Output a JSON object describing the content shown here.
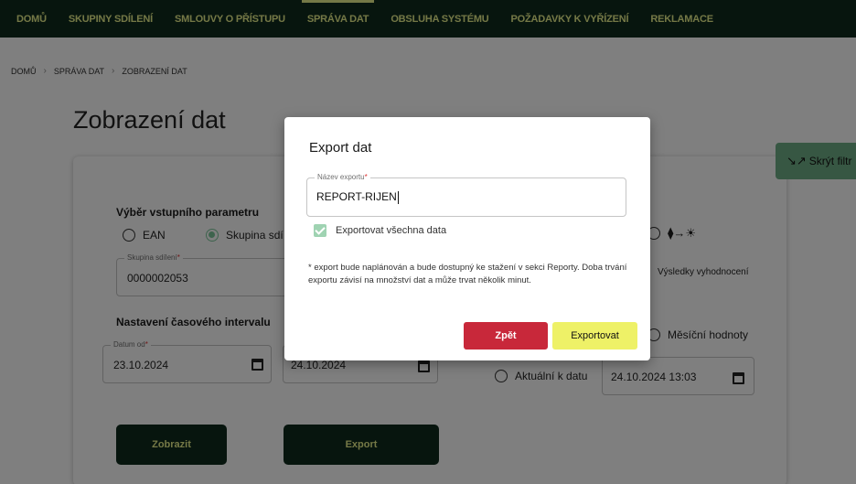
{
  "nav": {
    "items": [
      {
        "label": "DOMŮ"
      },
      {
        "label": "SKUPINY SDÍLENÍ"
      },
      {
        "label": "SMLOUVY O PŘÍSTUPU"
      },
      {
        "label": "SPRÁVA DAT"
      },
      {
        "label": "OBSLUHA SYSTÉMU"
      },
      {
        "label": "POŽADAVKY K VYŘÍZENÍ"
      },
      {
        "label": "REKLAMACE"
      }
    ],
    "active": "SPRÁVA DAT"
  },
  "breadcrumb": [
    "DOMŮ",
    "SPRÁVA DAT",
    "ZOBRAZENÍ DAT"
  ],
  "page": {
    "title": "Zobrazení dat",
    "input_section": {
      "title": "Výběr vstupního parametru",
      "radio_ean": "EAN",
      "radio_group": "Skupina sdí",
      "group_field_label": "Skupina sdílení",
      "group_field_value": "0000002053"
    },
    "interval_section": {
      "title": "Nastavení časového intervalu",
      "date_from_label": "Datum od",
      "date_from_value": "23.10.2024",
      "date_to_value": "24.10.2024"
    },
    "right": {
      "results_label": "Výsledky vyhodnocení",
      "monthly_label": "Měsíční hodnoty",
      "current_label": "Aktuální k datu",
      "current_value": "24.10.2024 13:03"
    },
    "buttons": {
      "show": "Zobrazit",
      "export": "Export"
    },
    "side_filter": "Skrýt filtr"
  },
  "dialog": {
    "title": "Export dat",
    "field_label": "Název exportu",
    "field_value": "REPORT-RIJEN",
    "checkbox_label": "Exportovat všechna data",
    "note": "* export bude naplánován a bude dostupný ke stažení v sekci Reporty. Doba trvání exportu závisí na množství dat a může trvat několik minut.",
    "back_button": "Zpět",
    "export_button": "Exportovat"
  },
  "colors": {
    "nav_bg": "#0f2b1c",
    "nav_text": "#e8f08c",
    "accent_green": "#7cc79a",
    "danger": "#c8283a",
    "highlight_yellow": "#eef167"
  }
}
